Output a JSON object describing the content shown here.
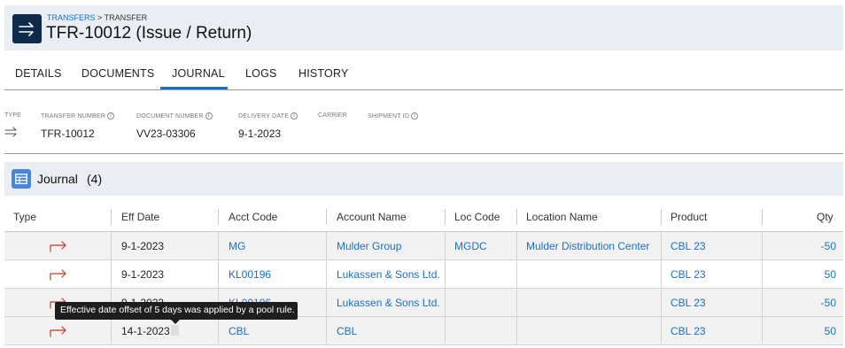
{
  "header": {
    "breadcrumb_link": "TRANSFERS",
    "breadcrumb_sep": ">",
    "breadcrumb_current": "TRANSFER",
    "title": "TFR-10012 (Issue / Return)",
    "icon": "transfer-arrows-icon"
  },
  "tabs": [
    {
      "label": "DETAILS"
    },
    {
      "label": "DOCUMENTS"
    },
    {
      "label": "JOURNAL",
      "active": true
    },
    {
      "label": "LOGS"
    },
    {
      "label": "HISTORY"
    }
  ],
  "info": {
    "type_label": "TYPE",
    "transfer_number_label": "TRANSFER NUMBER",
    "transfer_number": "TFR-10012",
    "document_number_label": "DOCUMENT NUMBER",
    "document_number": "VV23-03306",
    "delivery_date_label": "DELIVERY DATE",
    "delivery_date": "9-1-2023",
    "carrier_label": "CARRIER",
    "shipment_id_label": "SHIPMENT ID"
  },
  "journal": {
    "title": "Journal",
    "count": "(4)",
    "columns": {
      "type": "Type",
      "eff_date": "Eff Date",
      "acct_code": "Acct Code",
      "account_name": "Account Name",
      "loc_code": "Loc Code",
      "location_name": "Location Name",
      "product": "Product",
      "qty": "Qty"
    },
    "rows": [
      {
        "eff_date": "9-1-2023",
        "acct_code": "MG",
        "account_name": "Mulder Group",
        "loc_code": "MGDC",
        "location_name": "Mulder Distribution Center",
        "product": "CBL 23",
        "qty": "-50"
      },
      {
        "eff_date": "9-1-2023",
        "acct_code": "KL00196",
        "account_name": "Lukassen & Sons Ltd.",
        "loc_code": "",
        "location_name": "",
        "product": "CBL 23",
        "qty": "50"
      },
      {
        "eff_date": "9-1-2023",
        "acct_code": "KL00196",
        "account_name": "Lukassen & Sons Ltd.",
        "loc_code": "",
        "location_name": "",
        "product": "CBL 23",
        "qty": "-50"
      },
      {
        "eff_date": "14-1-2023",
        "acct_code": "CBL",
        "account_name": "CBL",
        "loc_code": "",
        "location_name": "",
        "product": "CBL 23",
        "qty": "50"
      }
    ]
  },
  "tooltip": {
    "text": "Effective date offset of 5 days was applied by a pool rule."
  },
  "colors": {
    "link": "#1b6fc4",
    "type_arrow": "#c0392b",
    "header_bg": "#e9eef5",
    "header_icon_bg": "#0f2a4a"
  }
}
